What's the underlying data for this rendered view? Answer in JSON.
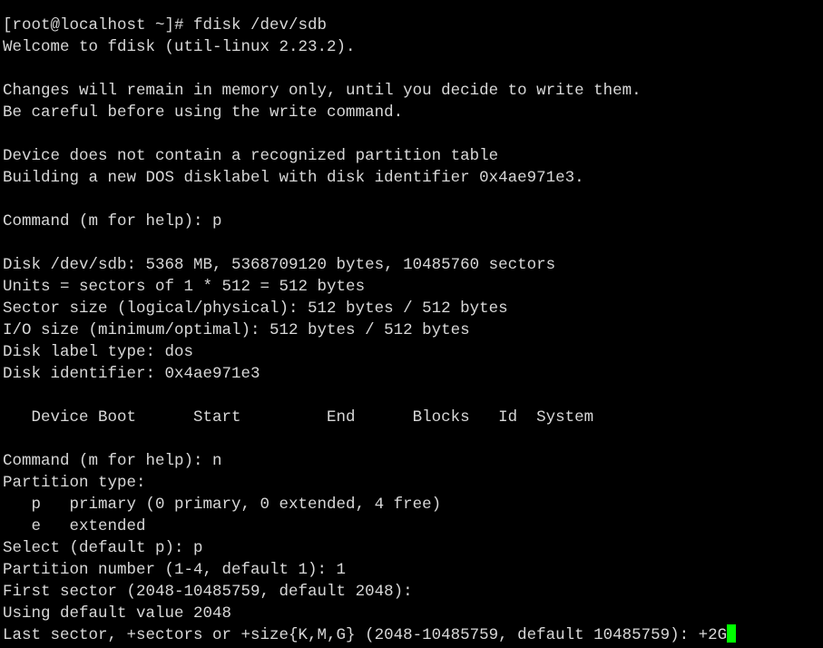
{
  "terminal": {
    "lines": [
      "[root@localhost ~]# fdisk /dev/sdb",
      "Welcome to fdisk (util-linux 2.23.2).",
      "",
      "Changes will remain in memory only, until you decide to write them.",
      "Be careful before using the write command.",
      "",
      "Device does not contain a recognized partition table",
      "Building a new DOS disklabel with disk identifier 0x4ae971e3.",
      "",
      "Command (m for help): p",
      "",
      "Disk /dev/sdb: 5368 MB, 5368709120 bytes, 10485760 sectors",
      "Units = sectors of 1 * 512 = 512 bytes",
      "Sector size (logical/physical): 512 bytes / 512 bytes",
      "I/O size (minimum/optimal): 512 bytes / 512 bytes",
      "Disk label type: dos",
      "Disk identifier: 0x4ae971e3",
      "",
      "   Device Boot      Start         End      Blocks   Id  System",
      "",
      "Command (m for help): n",
      "Partition type:",
      "   p   primary (0 primary, 0 extended, 4 free)",
      "   e   extended",
      "Select (default p): p",
      "Partition number (1-4, default 1): 1",
      "First sector (2048-10485759, default 2048):",
      "Using default value 2048"
    ],
    "prompt_line": "Last sector, +sectors or +size{K,M,G} (2048-10485759, default 10485759): +2G",
    "colors": {
      "background": "#000000",
      "text": "#d8d8d8",
      "cursor": "#00ff00"
    }
  }
}
